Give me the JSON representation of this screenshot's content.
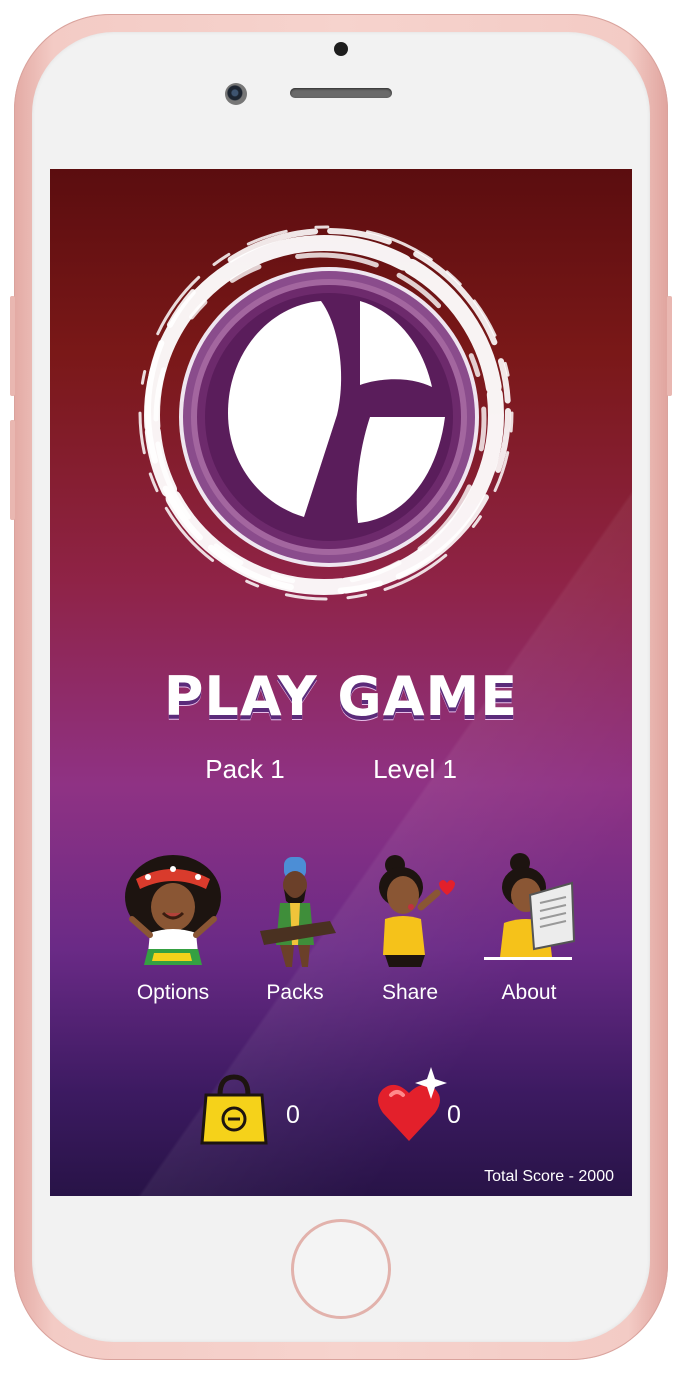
{
  "screen": {
    "title": "PLAY GAME",
    "pack": "Pack 1",
    "level": "Level 1",
    "menu": [
      {
        "label": "Options",
        "icon": "woman-headwrap-avatar-icon"
      },
      {
        "label": "Packs",
        "icon": "man-headwrap-avatar-icon"
      },
      {
        "label": "Share",
        "icon": "woman-blowing-kiss-avatar-icon"
      },
      {
        "label": "About",
        "icon": "woman-reading-avatar-icon"
      }
    ],
    "counters": {
      "bag_count": "0",
      "hearts_count": "0"
    },
    "total_score": "Total Score - 2000"
  },
  "colors": {
    "background_top": "#5b0d0f",
    "background_mid": "#8f3284",
    "background_bottom": "#281347",
    "logo_purple": "#5e1f5e",
    "heart": "#e3202b",
    "bag": "#f5d21a"
  }
}
